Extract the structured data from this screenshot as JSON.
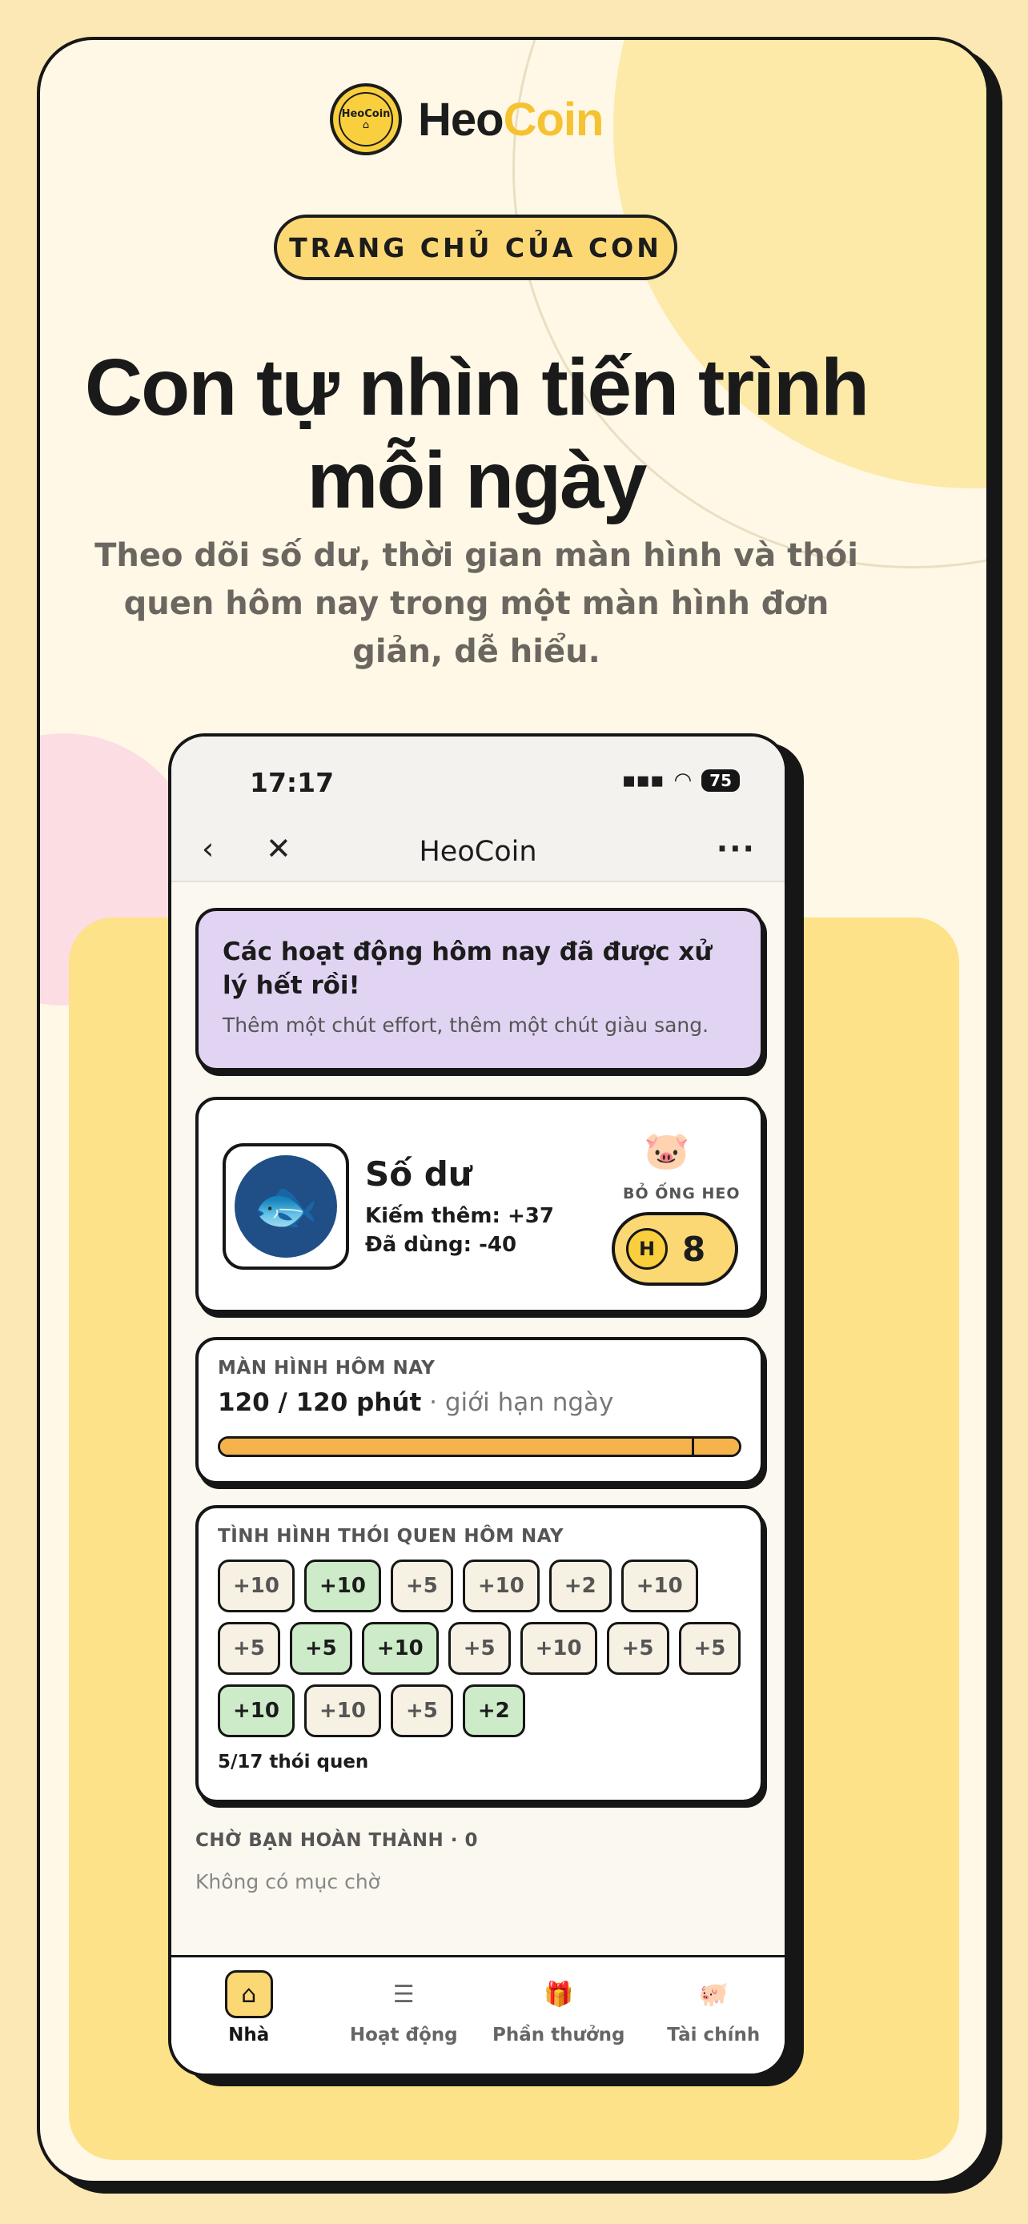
{
  "brand": {
    "name_main": "Heo",
    "name_accent": "Coin",
    "coin_text": "HeoCoin",
    "coin_icon": "house-icon"
  },
  "pill": "TRANG CHỦ CỦA CON",
  "headline": "Con tự nhìn tiến trình mỗi ngày",
  "subhead": "Theo dõi số dư, thời gian màn hình và thói quen hôm nay trong một màn hình đơn giản, dễ hiểu.",
  "status": {
    "time": "17:17",
    "battery": "75"
  },
  "nav": {
    "title": "HeoCoin",
    "back": "‹",
    "close": "✕",
    "more": "···"
  },
  "alert": {
    "title": "Các hoạt động hôm nay đã được xử lý hết rồi!",
    "subtitle": "Thêm một chút effort, thêm một chút giàu sang."
  },
  "balance": {
    "title": "Số dư",
    "earned": "Kiếm thêm: +37",
    "used": "Đã dùng: -40",
    "piggy_label": "BỎ ỐNG HEO",
    "coin_letter": "H",
    "piggy_value": "8"
  },
  "screen_time": {
    "label": "MÀN HÌNH HÔM NAY",
    "value": "120 / 120 phút",
    "suffix": "· giới hạn ngày",
    "progress": 1.0
  },
  "habits": {
    "label": "TÌNH HÌNH THÓI QUEN HÔM NAY",
    "chips": [
      {
        "text": "+10",
        "done": false
      },
      {
        "text": "+10",
        "done": true
      },
      {
        "text": "+5",
        "done": false
      },
      {
        "text": "+10",
        "done": false
      },
      {
        "text": "+2",
        "done": false
      },
      {
        "text": "+10",
        "done": false
      },
      {
        "text": "+5",
        "done": false
      },
      {
        "text": "+5",
        "done": true
      },
      {
        "text": "+10",
        "done": true
      },
      {
        "text": "+5",
        "done": false
      },
      {
        "text": "+10",
        "done": false
      },
      {
        "text": "+5",
        "done": false
      },
      {
        "text": "+5",
        "done": false
      },
      {
        "text": "+10",
        "done": true
      },
      {
        "text": "+10",
        "done": false
      },
      {
        "text": "+5",
        "done": false
      },
      {
        "text": "+2",
        "done": true
      }
    ],
    "count": "5/17 thói quen"
  },
  "waiting": {
    "title": "CHỜ BẠN HOÀN THÀNH · 0",
    "empty": "Không có mục chờ"
  },
  "tabs": [
    {
      "label": "Nhà",
      "icon": "home-icon",
      "glyph": "⌂",
      "active": true
    },
    {
      "label": "Hoạt động",
      "icon": "list-icon",
      "glyph": "☰",
      "active": false
    },
    {
      "label": "Phần thưởng",
      "icon": "gift-icon",
      "glyph": "🎁",
      "active": false
    },
    {
      "label": "Tài chính",
      "icon": "piggy-icon",
      "glyph": "🐖",
      "active": false
    }
  ]
}
